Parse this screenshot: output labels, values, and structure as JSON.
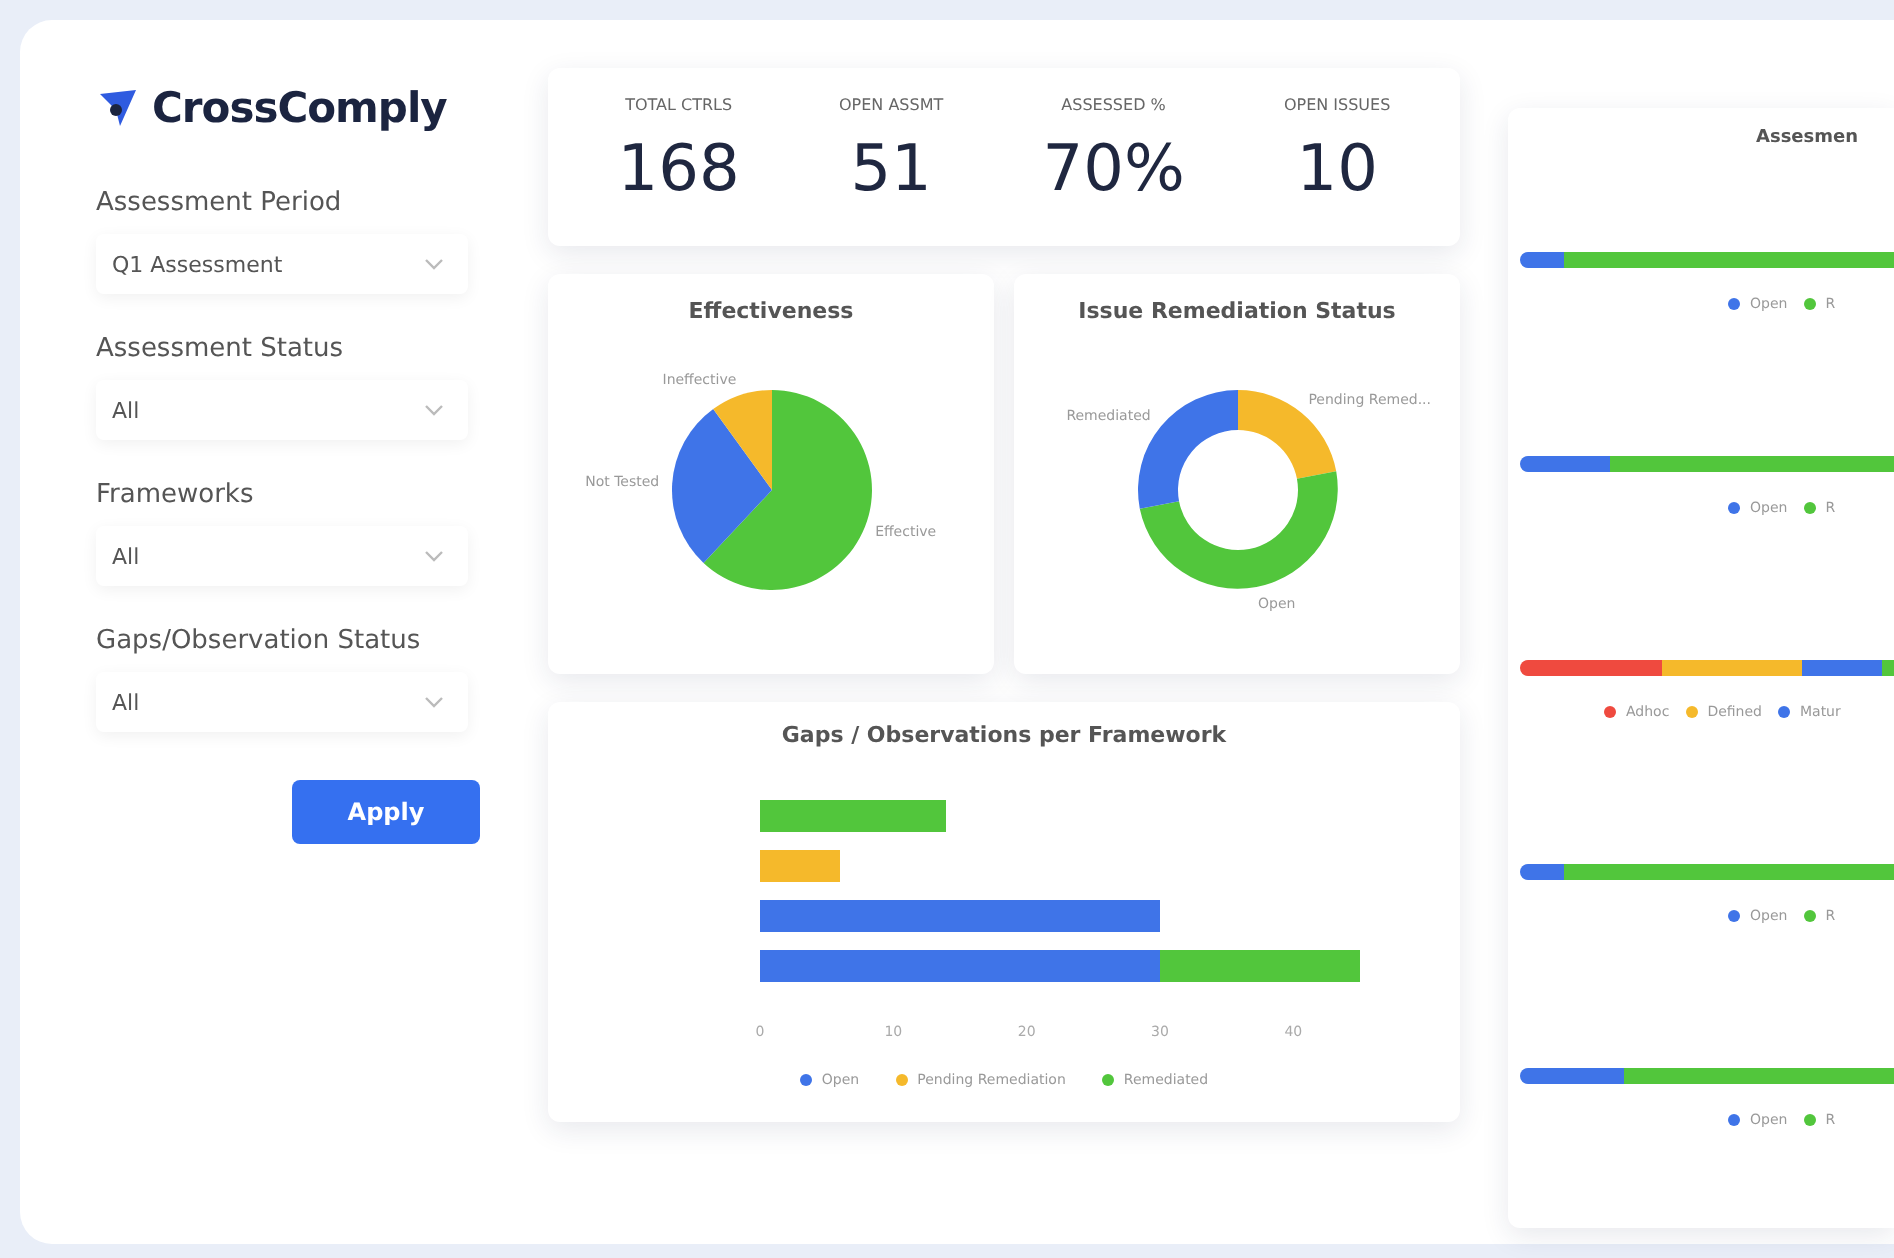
{
  "brand": "CrossComply",
  "filters": [
    {
      "label": "Assessment Period",
      "value": "Q1 Assessment"
    },
    {
      "label": "Assessment Status",
      "value": "All"
    },
    {
      "label": "Frameworks",
      "value": "All"
    },
    {
      "label": "Gaps/Observation Status",
      "value": "All"
    }
  ],
  "apply_button": "Apply",
  "kpis": [
    {
      "label": "TOTAL CTRLS",
      "value": "168"
    },
    {
      "label": "OPEN ASSMT",
      "value": "51"
    },
    {
      "label": "ASSESSED %",
      "value": "70%"
    },
    {
      "label": "OPEN ISSUES",
      "value": "10"
    }
  ],
  "effectiveness": {
    "title": "Effectiveness",
    "chart_data": {
      "type": "pie",
      "categories": [
        "Effective",
        "Not Tested",
        "Ineffective"
      ],
      "values": [
        62,
        28,
        10
      ],
      "colors": [
        "#52c63c",
        "#3f74e8",
        "#f5b92b"
      ]
    }
  },
  "remediation": {
    "title": "Issue Remediation Status",
    "chart_data": {
      "type": "donut",
      "categories": [
        "Pending Remed...",
        "Open",
        "Remediated"
      ],
      "values": [
        22,
        50,
        28
      ],
      "colors": [
        "#f5b92b",
        "#52c63c",
        "#3f74e8"
      ]
    }
  },
  "gaps": {
    "title": "Gaps / Observations per Framework",
    "chart_data": {
      "type": "bar",
      "orientation": "horizontal",
      "stacked": true,
      "xlim": [
        0,
        45
      ],
      "xticks": [
        0,
        10,
        20,
        30,
        40
      ],
      "series": [
        {
          "name": "Open",
          "color": "#3f74e8",
          "values": [
            0,
            0,
            30,
            30
          ]
        },
        {
          "name": "Pending Remediation",
          "color": "#f5b92b",
          "values": [
            0,
            6,
            0,
            0
          ]
        },
        {
          "name": "Remediated",
          "color": "#52c63c",
          "values": [
            14,
            0,
            0,
            15
          ]
        }
      ]
    }
  },
  "right_panel": {
    "title": "Assesmen",
    "bars": [
      {
        "segments": [
          {
            "color": "#3f74e8",
            "level": 0.12
          },
          {
            "color": "#52c63c"
          }
        ],
        "legend": [
          {
            "label": "Open",
            "color": "#3f74e8"
          },
          {
            "label": "R",
            "color": "#52c63c"
          }
        ]
      },
      {
        "segments": [
          {
            "color": "#3f74e8",
            "level": 0.24
          },
          {
            "color": "#52c63c"
          }
        ],
        "legend": [
          {
            "label": "Open",
            "color": "#3f74e8"
          },
          {
            "label": "R",
            "color": "#52c63c"
          }
        ]
      },
      {
        "segments": [
          {
            "color": "#ef4a3f",
            "level": 0.38
          },
          {
            "color": "#f5b92b",
            "level": 0.6
          },
          {
            "color": "#3f74e8",
            "level": 0.88
          },
          {
            "color": "#52c63c"
          }
        ],
        "legend": [
          {
            "label": "Adhoc",
            "color": "#ef4a3f"
          },
          {
            "label": "Defined",
            "color": "#f5b92b"
          },
          {
            "label": "Matur",
            "color": "#3f74e8"
          }
        ]
      },
      {
        "segments": [
          {
            "color": "#3f74e8",
            "level": 0.12
          },
          {
            "color": "#52c63c"
          }
        ],
        "legend": [
          {
            "label": "Open",
            "color": "#3f74e8"
          },
          {
            "label": "R",
            "color": "#52c63c"
          }
        ]
      },
      {
        "segments": [
          {
            "color": "#3f74e8",
            "level": 0.28
          },
          {
            "color": "#52c63c"
          }
        ],
        "legend": [
          {
            "label": "Open",
            "color": "#3f74e8"
          },
          {
            "label": "R",
            "color": "#52c63c"
          }
        ]
      }
    ]
  }
}
